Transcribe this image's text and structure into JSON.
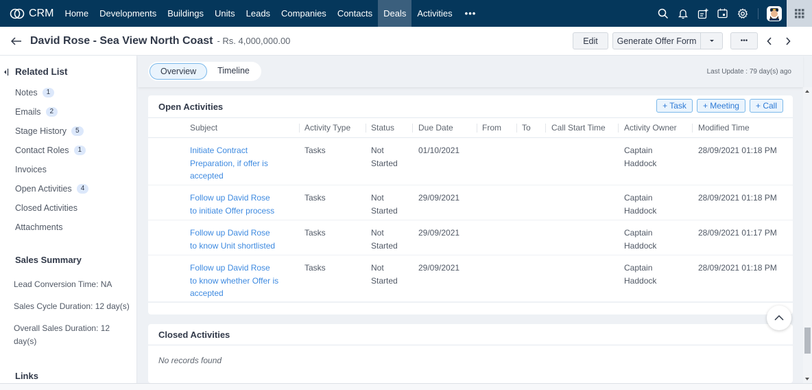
{
  "nav": {
    "brand": "CRM",
    "items": [
      "Home",
      "Developments",
      "Buildings",
      "Units",
      "Leads",
      "Companies",
      "Contacts",
      "Deals",
      "Activities"
    ],
    "active": "Deals",
    "more": "•••"
  },
  "record": {
    "title": "David Rose - Sea View North Coast",
    "amount": "- Rs. 4,000,000.00",
    "edit_label": "Edit",
    "generate_label": "Generate Offer Form",
    "more_label": "•••"
  },
  "related": {
    "title": "Related List",
    "items": [
      {
        "label": "Notes",
        "count": "1"
      },
      {
        "label": "Emails",
        "count": "2"
      },
      {
        "label": "Stage History",
        "count": "5"
      },
      {
        "label": "Contact Roles",
        "count": "1"
      },
      {
        "label": "Invoices",
        "count": null
      },
      {
        "label": "Open Activities",
        "count": "4"
      },
      {
        "label": "Closed Activities",
        "count": null
      },
      {
        "label": "Attachments",
        "count": null
      }
    ]
  },
  "sales_summary": {
    "title": "Sales Summary",
    "items": [
      "Lead Conversion Time: NA",
      "Sales Cycle Duration: 12 day(s)",
      "Overall Sales Duration: 12 day(s)"
    ]
  },
  "links_title": "Links",
  "tabs": [
    "Overview",
    "Timeline"
  ],
  "active_tab": "Overview",
  "last_update": "Last Update : 79 day(s) ago",
  "open_activities": {
    "title": "Open Activities",
    "buttons": [
      "+ Task",
      "+ Meeting",
      "+ Call"
    ],
    "columns": [
      "Subject",
      "Activity Type",
      "Status",
      "Due Date",
      "From",
      "To",
      "Call Start Time",
      "Activity Owner",
      "Modified Time"
    ],
    "rows": [
      {
        "subject": "Initiate Contract Preparation, if offer is accepted",
        "type": "Tasks",
        "status": "Not Started",
        "due": "01/10/2021",
        "from": "",
        "to": "",
        "call_start": "",
        "owner": "Captain Haddock",
        "modified": "28/09/2021 01:18 PM"
      },
      {
        "subject": "Follow up David Rose to initiate Offer process",
        "type": "Tasks",
        "status": "Not Started",
        "due": "29/09/2021",
        "from": "",
        "to": "",
        "call_start": "",
        "owner": "Captain Haddock",
        "modified": "28/09/2021 01:18 PM"
      },
      {
        "subject": "Follow up David Rose to know Unit shortlisted",
        "type": "Tasks",
        "status": "Not Started",
        "due": "29/09/2021",
        "from": "",
        "to": "",
        "call_start": "",
        "owner": "Captain Haddock",
        "modified": "28/09/2021 01:17 PM"
      },
      {
        "subject": "Follow up David Rose to know whether Offer is accepted",
        "type": "Tasks",
        "status": "Not Started",
        "due": "29/09/2021",
        "from": "",
        "to": "",
        "call_start": "",
        "owner": "Captain Haddock",
        "modified": "28/09/2021 01:18 PM"
      }
    ]
  },
  "closed_activities": {
    "title": "Closed Activities",
    "empty": "No records found"
  },
  "colors": {
    "nav_bg": "#05375b",
    "nav_active": "#3b5f7d",
    "link": "#3e8ae0",
    "accent_border": "#7ab8ea",
    "badge_bg": "#dce8fb"
  }
}
